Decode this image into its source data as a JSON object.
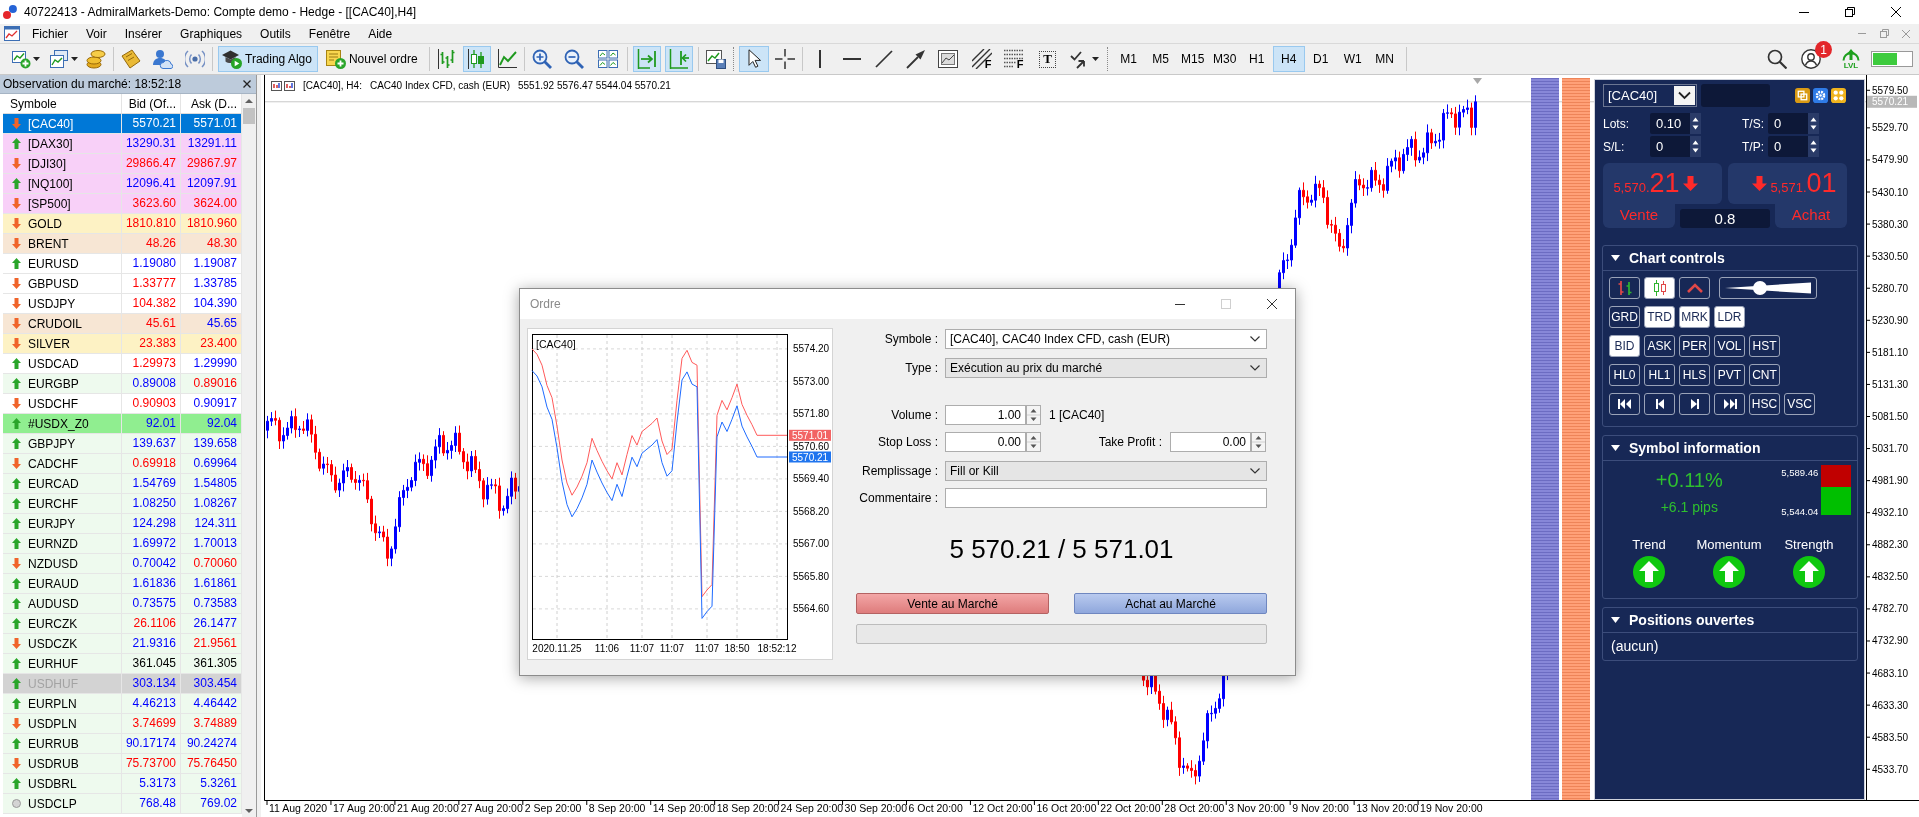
{
  "window": {
    "title": "40722413 - AdmiralMarkets-Demo: Compte demo - Hedge - [[CAC40],H4]"
  },
  "menu": [
    "Fichier",
    "Voir",
    "Insérer",
    "Graphiques",
    "Outils",
    "Fenêtre",
    "Aide"
  ],
  "toolbar": {
    "trade_buttons": [
      {
        "label": "Trading Algo",
        "selected": true
      },
      {
        "label": "Nouvel ordre",
        "selected": false
      }
    ],
    "chart_types": [
      {
        "selected": false
      },
      {
        "selected": true
      },
      {
        "selected": false
      }
    ],
    "scroll_modes": [
      {
        "selected": true
      },
      {
        "selected": true
      }
    ],
    "cursor_modes": [
      {
        "selected": true
      },
      {
        "selected": false
      }
    ],
    "tool_letters": [
      "F",
      "F",
      "T"
    ],
    "timeframes": [
      {
        "label": "M1",
        "selected": false
      },
      {
        "label": "M5",
        "selected": false
      },
      {
        "label": "M15",
        "selected": false
      },
      {
        "label": "M30",
        "selected": false
      },
      {
        "label": "H1",
        "selected": false
      },
      {
        "label": "H4",
        "selected": true
      },
      {
        "label": "D1",
        "selected": false
      },
      {
        "label": "W1",
        "selected": false
      },
      {
        "label": "MN",
        "selected": false
      }
    ],
    "account_badge": "1",
    "level_label": "LVL"
  },
  "market_watch": {
    "title": "Observation du marché: 18:52:18",
    "columns": [
      "Symbole",
      "Bid (Of...",
      "Ask (D..."
    ],
    "rows": [
      {
        "symbol": "[CAC40]",
        "kind": "down",
        "selected": true,
        "disabled": false,
        "bid": {
          "text": "5570.21"
        },
        "ask": {
          "text": "5571.01"
        }
      },
      {
        "symbol": "[DAX30]",
        "kind": "up",
        "selected": false,
        "disabled": false,
        "color": "#f8d0f8",
        "bid": {
          "text": "13290.31",
          "color": "#0000ff"
        },
        "ask": {
          "text": "13291.11",
          "color": "#0000ff"
        }
      },
      {
        "symbol": "[DJI30]",
        "kind": "down",
        "selected": false,
        "disabled": false,
        "color": "#f8d0f8",
        "bid": {
          "text": "29866.47",
          "color": "#ff0000"
        },
        "ask": {
          "text": "29867.97",
          "color": "#ff0000"
        }
      },
      {
        "symbol": "[NQ100]",
        "kind": "up",
        "selected": false,
        "disabled": false,
        "color": "#f8d0f8",
        "bid": {
          "text": "12096.41",
          "color": "#0000ff"
        },
        "ask": {
          "text": "12097.91",
          "color": "#0000ff"
        }
      },
      {
        "symbol": "[SP500]",
        "kind": "down",
        "selected": false,
        "disabled": false,
        "color": "#f8d0f8",
        "bid": {
          "text": "3623.60",
          "color": "#ff0000"
        },
        "ask": {
          "text": "3624.00",
          "color": "#ff0000"
        }
      },
      {
        "symbol": "GOLD",
        "kind": "down",
        "selected": false,
        "disabled": false,
        "color": "#fdf2c4",
        "bid": {
          "text": "1810.810",
          "color": "#ff0000"
        },
        "ask": {
          "text": "1810.960",
          "color": "#ff0000"
        }
      },
      {
        "symbol": "BRENT",
        "kind": "down",
        "selected": false,
        "disabled": false,
        "color": "#f7e6d4",
        "bid": {
          "text": "48.26",
          "color": "#ff0000"
        },
        "ask": {
          "text": "48.30",
          "color": "#ff0000"
        }
      },
      {
        "symbol": "EURUSD",
        "kind": "up",
        "selected": false,
        "disabled": false,
        "color": "#ffffff",
        "bid": {
          "text": "1.19080",
          "color": "#0000ff"
        },
        "ask": {
          "text": "1.19087",
          "color": "#0000ff"
        }
      },
      {
        "symbol": "GBPUSD",
        "kind": "down",
        "selected": false,
        "disabled": false,
        "color": "#ffffff",
        "bid": {
          "text": "1.33777",
          "color": "#ff0000"
        },
        "ask": {
          "text": "1.33785",
          "color": "#0000ff"
        }
      },
      {
        "symbol": "USDJPY",
        "kind": "down",
        "selected": false,
        "disabled": false,
        "color": "#ffffff",
        "bid": {
          "text": "104.382",
          "color": "#ff0000"
        },
        "ask": {
          "text": "104.390",
          "color": "#0000ff"
        }
      },
      {
        "symbol": "CRUDOIL",
        "kind": "down",
        "selected": false,
        "disabled": false,
        "color": "#f7e6d4",
        "bid": {
          "text": "45.61",
          "color": "#ff0000"
        },
        "ask": {
          "text": "45.65",
          "color": "#0000ff"
        }
      },
      {
        "symbol": "SILVER",
        "kind": "down",
        "selected": false,
        "disabled": false,
        "color": "#fdf2c4",
        "bid": {
          "text": "23.383",
          "color": "#ff0000"
        },
        "ask": {
          "text": "23.400",
          "color": "#ff0000"
        }
      },
      {
        "symbol": "USDCAD",
        "kind": "up",
        "selected": false,
        "disabled": false,
        "color": "#ffffff",
        "bid": {
          "text": "1.29973",
          "color": "#ff0000"
        },
        "ask": {
          "text": "1.29990",
          "color": "#0000ff"
        }
      },
      {
        "symbol": "EURGBP",
        "kind": "up",
        "selected": false,
        "disabled": false,
        "color": "#eefaee",
        "bid": {
          "text": "0.89008",
          "color": "#0000ff"
        },
        "ask": {
          "text": "0.89016",
          "color": "#ff0000"
        }
      },
      {
        "symbol": "USDCHF",
        "kind": "down",
        "selected": false,
        "disabled": false,
        "color": "#ffffff",
        "bid": {
          "text": "0.90903",
          "color": "#ff0000"
        },
        "ask": {
          "text": "0.90917",
          "color": "#0000ff"
        }
      },
      {
        "symbol": "#USDX_Z0",
        "kind": "up",
        "selected": false,
        "disabled": false,
        "color": "#90ee90",
        "bid": {
          "text": "92.01",
          "color": "#0000ff"
        },
        "ask": {
          "text": "92.04",
          "color": "#0000ff"
        }
      },
      {
        "symbol": "GBPJPY",
        "kind": "up",
        "selected": false,
        "disabled": false,
        "color": "#eefaee",
        "bid": {
          "text": "139.637",
          "color": "#0000ff"
        },
        "ask": {
          "text": "139.658",
          "color": "#0000ff"
        }
      },
      {
        "symbol": "CADCHF",
        "kind": "down",
        "selected": false,
        "disabled": false,
        "color": "#eefaee",
        "bid": {
          "text": "0.69918",
          "color": "#ff0000"
        },
        "ask": {
          "text": "0.69964",
          "color": "#0000ff"
        }
      },
      {
        "symbol": "EURCAD",
        "kind": "up",
        "selected": false,
        "disabled": false,
        "color": "#eefaee",
        "bid": {
          "text": "1.54769",
          "color": "#0000ff"
        },
        "ask": {
          "text": "1.54805",
          "color": "#0000ff"
        }
      },
      {
        "symbol": "EURCHF",
        "kind": "up",
        "selected": false,
        "disabled": false,
        "color": "#eefaee",
        "bid": {
          "text": "1.08250",
          "color": "#0000ff"
        },
        "ask": {
          "text": "1.08267",
          "color": "#0000ff"
        }
      },
      {
        "symbol": "EURJPY",
        "kind": "up",
        "selected": false,
        "disabled": false,
        "color": "#eefaee",
        "bid": {
          "text": "124.298",
          "color": "#0000ff"
        },
        "ask": {
          "text": "124.311",
          "color": "#0000ff"
        }
      },
      {
        "symbol": "EURNZD",
        "kind": "up",
        "selected": false,
        "disabled": false,
        "color": "#eefaee",
        "bid": {
          "text": "1.69972",
          "color": "#0000ff"
        },
        "ask": {
          "text": "1.70013",
          "color": "#0000ff"
        }
      },
      {
        "symbol": "NZDUSD",
        "kind": "down",
        "selected": false,
        "disabled": false,
        "color": "#eefaee",
        "bid": {
          "text": "0.70042",
          "color": "#0000ff"
        },
        "ask": {
          "text": "0.70060",
          "color": "#ff0000"
        }
      },
      {
        "symbol": "EURAUD",
        "kind": "up",
        "selected": false,
        "disabled": false,
        "color": "#eefaee",
        "bid": {
          "text": "1.61836",
          "color": "#0000ff"
        },
        "ask": {
          "text": "1.61861",
          "color": "#0000ff"
        }
      },
      {
        "symbol": "AUDUSD",
        "kind": "up",
        "selected": false,
        "disabled": false,
        "color": "#eefaee",
        "bid": {
          "text": "0.73575",
          "color": "#0000ff"
        },
        "ask": {
          "text": "0.73583",
          "color": "#0000ff"
        }
      },
      {
        "symbol": "EURCZK",
        "kind": "up",
        "selected": false,
        "disabled": false,
        "color": "#eefaee",
        "bid": {
          "text": "26.1106",
          "color": "#ff0000"
        },
        "ask": {
          "text": "26.1477",
          "color": "#0000ff"
        }
      },
      {
        "symbol": "USDCZK",
        "kind": "down",
        "selected": false,
        "disabled": false,
        "color": "#eefaee",
        "bid": {
          "text": "21.9316",
          "color": "#0000ff"
        },
        "ask": {
          "text": "21.9561",
          "color": "#ff0000"
        }
      },
      {
        "symbol": "EURHUF",
        "kind": "up",
        "selected": false,
        "disabled": false,
        "color": "#eefaee",
        "bid": {
          "text": "361.045",
          "color": "#000000"
        },
        "ask": {
          "text": "361.305",
          "color": "#000000"
        }
      },
      {
        "symbol": "USDHUF",
        "kind": "up",
        "selected": false,
        "disabled": true,
        "color": "#d3d3d3",
        "bid": {
          "text": "303.134",
          "color": "#0000ff"
        },
        "ask": {
          "text": "303.454",
          "color": "#0000ff"
        }
      },
      {
        "symbol": "EURPLN",
        "kind": "up",
        "selected": false,
        "disabled": false,
        "color": "#eefaee",
        "bid": {
          "text": "4.46213",
          "color": "#0000ff"
        },
        "ask": {
          "text": "4.46442",
          "color": "#0000ff"
        }
      },
      {
        "symbol": "USDPLN",
        "kind": "down",
        "selected": false,
        "disabled": false,
        "color": "#eefaee",
        "bid": {
          "text": "3.74699",
          "color": "#ff0000"
        },
        "ask": {
          "text": "3.74889",
          "color": "#ff0000"
        }
      },
      {
        "symbol": "EURRUB",
        "kind": "up",
        "selected": false,
        "disabled": false,
        "color": "#eefaee",
        "bid": {
          "text": "90.17174",
          "color": "#0000ff"
        },
        "ask": {
          "text": "90.24274",
          "color": "#0000ff"
        }
      },
      {
        "symbol": "USDRUB",
        "kind": "down",
        "selected": false,
        "disabled": false,
        "color": "#eefaee",
        "bid": {
          "text": "75.73700",
          "color": "#ff0000"
        },
        "ask": {
          "text": "75.76450",
          "color": "#ff0000"
        }
      },
      {
        "symbol": "USDBRL",
        "kind": "up",
        "selected": false,
        "disabled": false,
        "color": "#eefaee",
        "bid": {
          "text": "5.3173",
          "color": "#0000ff"
        },
        "ask": {
          "text": "5.3261",
          "color": "#0000ff"
        }
      },
      {
        "symbol": "USDCLP",
        "kind": "none",
        "selected": false,
        "disabled": false,
        "color": "#eefaee",
        "bid": {
          "text": "768.48",
          "color": "#0000ff"
        },
        "ask": {
          "text": "769.02",
          "color": "#0000ff"
        }
      }
    ]
  },
  "chart": {
    "header": {
      "symbol": "[CAC40], H4:",
      "description": "CAC40 Index CFD, cash (EUR)",
      "ohlc": "5551.92 5576.47 5544.04 5570.21"
    },
    "price_labels": [
      "5579.50",
      "5529.70",
      "5479.90",
      "5430.10",
      "5380.30",
      "5330.50",
      "5280.70",
      "5230.90",
      "5181.10",
      "5131.30",
      "5081.50",
      "5031.70",
      "4981.90",
      "4932.10",
      "4882.30",
      "4832.50",
      "4782.70",
      "4732.90",
      "4683.10",
      "4633.30",
      "4583.50",
      "4533.70"
    ],
    "bid_tag": "5570.21",
    "time_labels": [
      "11 Aug 2020",
      "17 Aug 20:00",
      "21 Aug 20:00",
      "27 Aug 20:00",
      "2 Sep 20:00",
      "8 Sep 20:00",
      "14 Sep 20:00",
      "18 Sep 20:00",
      "24 Sep 20:00",
      "30 Sep 20:00",
      "6 Oct 20:00",
      "12 Oct 20:00",
      "16 Oct 20:00",
      "22 Oct 20:00",
      "28 Oct 20:00",
      "3 Nov 20:00",
      "9 Nov 20:00",
      "13 Nov 20:00",
      "19 Nov 20:00"
    ]
  },
  "trade_panel": {
    "symbol": "[CAC40]",
    "fields": [
      {
        "label": "Lots:",
        "value": "0.10"
      },
      {
        "label": "T/S:",
        "value": "0"
      },
      {
        "label": "S/L:",
        "value": "0"
      },
      {
        "label": "T/P:",
        "value": "0"
      }
    ],
    "sell": {
      "price_main": "5,570.",
      "price_pips": "21",
      "label": "Vente",
      "kind": "down"
    },
    "buy": {
      "price_main": "5,571.",
      "price_pips": "01",
      "label": "Achat",
      "kind": "down"
    },
    "spread": "0.8",
    "chart_controls": {
      "title": "Chart controls",
      "expanded": true,
      "chart_types": [
        {
          "selected": false
        },
        {
          "selected": true
        },
        {
          "selected": false
        }
      ],
      "slider": {
        "level": 0.41
      },
      "button_rows": [
        [
          {
            "label": "GRD",
            "selected": false
          },
          {
            "label": "TRD",
            "selected": true
          },
          {
            "label": "MRK",
            "selected": true
          },
          {
            "label": "LDR",
            "selected": true
          }
        ],
        [
          {
            "label": "BID",
            "selected": true
          },
          {
            "label": "ASK",
            "selected": false
          },
          {
            "label": "PER",
            "selected": false
          },
          {
            "label": "VOL",
            "selected": false
          },
          {
            "label": "HST",
            "selected": false
          }
        ],
        [
          {
            "label": "HL0",
            "selected": false
          },
          {
            "label": "HL1",
            "selected": false
          },
          {
            "label": "HLS",
            "selected": false
          },
          {
            "label": "PVT",
            "selected": false
          },
          {
            "label": "CNT",
            "selected": false
          }
        ]
      ],
      "nav_buttons": [
        {
          "label": "HSC",
          "selected": false
        },
        {
          "label": "VSC",
          "selected": false
        }
      ]
    },
    "symbol_info": {
      "title": "Symbol information",
      "expanded": true,
      "change": "+0.11%",
      "pips": "+6.1 pips",
      "high": "5,589.46",
      "low": "5,544.04",
      "range": {
        "level": 0.57
      },
      "indicators": [
        {
          "label": "Trend",
          "kind": "up"
        },
        {
          "label": "Momentum",
          "kind": "up"
        },
        {
          "label": "Strength",
          "kind": "up"
        }
      ]
    },
    "positions": {
      "title": "Positions ouvertes",
      "expanded": true,
      "empty_text": "(aucun)"
    }
  },
  "order_dialog": {
    "title": "Ordre",
    "chart_data": {
      "type": "line",
      "title": "[CAC40]",
      "grid": true,
      "categories": [
        null,
        null,
        null,
        null,
        null,
        "2020.11.25",
        null,
        null,
        null,
        null,
        null,
        null,
        null,
        null,
        null,
        "11:06",
        null,
        null,
        null,
        null,
        null,
        null,
        "11:07",
        null,
        null,
        null,
        null,
        null,
        "11:07",
        null,
        null,
        null,
        null,
        null,
        null,
        "11:07",
        null,
        null,
        null,
        null,
        null,
        "18:50",
        null,
        null,
        null,
        null,
        null,
        null,
        null,
        "18:52:12",
        null,
        null
      ],
      "ylim": [
        5563.49,
        5574.75
      ],
      "yticks": [
        {
          "value": 5574.2,
          "label": "5574.20"
        },
        {
          "value": 5573.0,
          "label": "5573.00"
        },
        {
          "value": 5571.8,
          "label": "5571.80"
        },
        {
          "value": 5570.6,
          "label": "5570.60"
        },
        {
          "value": 5569.4,
          "label": "5569.40"
        },
        {
          "value": 5568.2,
          "label": "5568.20"
        },
        {
          "value": 5567.0,
          "label": "5567.00"
        },
        {
          "value": 5565.8,
          "label": "5565.80"
        },
        {
          "value": 5564.6,
          "label": "5564.60"
        }
      ],
      "series": [
        {
          "color": "#ff5a5a",
          "values": [
            5574.2,
            5574.0,
            5573.6,
            5572.85,
            5572.4,
            5571.35,
            5570.1,
            5569.25,
            5568.8,
            5569.1,
            5569.5,
            5570.0,
            5570.9,
            5570.45,
            5570.05,
            5569.7,
            5569.4,
            5570.0,
            5569.55,
            5570.3,
            5571.0,
            5570.65,
            5571.15,
            5571.3,
            5571.45,
            5571.65,
            5570.8,
            5570.3,
            5570.5,
            5572.3,
            5573.85,
            5574.15,
            5573.7,
            5573.6,
            5565.05,
            5565.3,
            5565.5,
            5571.75,
            5572.3,
            5571.95,
            5572.4,
            5572.9,
            5572.15,
            5571.75,
            5571.4,
            5571.01,
            5571.01,
            5571.01,
            5571.01,
            5571.01,
            5571.01,
            5571.01
          ]
        },
        {
          "color": "#1e6bff",
          "values": [
            5573.4,
            5573.2,
            5572.8,
            5572.05,
            5571.6,
            5570.55,
            5569.3,
            5568.45,
            5568.0,
            5568.3,
            5568.7,
            5569.2,
            5570.1,
            5569.65,
            5569.25,
            5568.9,
            5568.6,
            5569.2,
            5568.75,
            5569.5,
            5570.2,
            5569.85,
            5570.35,
            5570.5,
            5570.65,
            5570.85,
            5570.0,
            5569.5,
            5569.7,
            5571.5,
            5573.05,
            5573.35,
            5572.9,
            5572.8,
            5564.25,
            5564.5,
            5564.7,
            5570.95,
            5571.5,
            5571.15,
            5571.6,
            5572.1,
            5571.35,
            5570.95,
            5570.6,
            5570.21,
            5570.21,
            5570.21,
            5570.21,
            5570.21,
            5570.21,
            5570.21
          ]
        }
      ]
    },
    "price_tags": [
      {
        "text": "5571.01",
        "color": "#f26464"
      },
      {
        "text": "5570.21",
        "color": "#1f74ee"
      }
    ],
    "symbol": {
      "label": "Symbole :",
      "value": "[CAC40], CAC40 Index CFD, cash (EUR)"
    },
    "type": {
      "label": "Type :",
      "value": "Exécution au prix du marché"
    },
    "volume": {
      "label": "Volume :",
      "value": "1.00",
      "unit": "1 [CAC40]"
    },
    "stop_loss": {
      "label": "Stop Loss :",
      "value": "0.00"
    },
    "take_profit": {
      "label": "Take Profit :",
      "value": "0.00"
    },
    "filling": {
      "label": "Remplissage :",
      "value": "Fill or Kill"
    },
    "comment": {
      "label": "Commentaire :"
    },
    "quote": "5 570.21 / 5 571.01",
    "buttons": [
      {
        "label": "Vente au Marché",
        "kind": "sell"
      },
      {
        "label": "Achat au Marché",
        "kind": "buy"
      }
    ]
  }
}
